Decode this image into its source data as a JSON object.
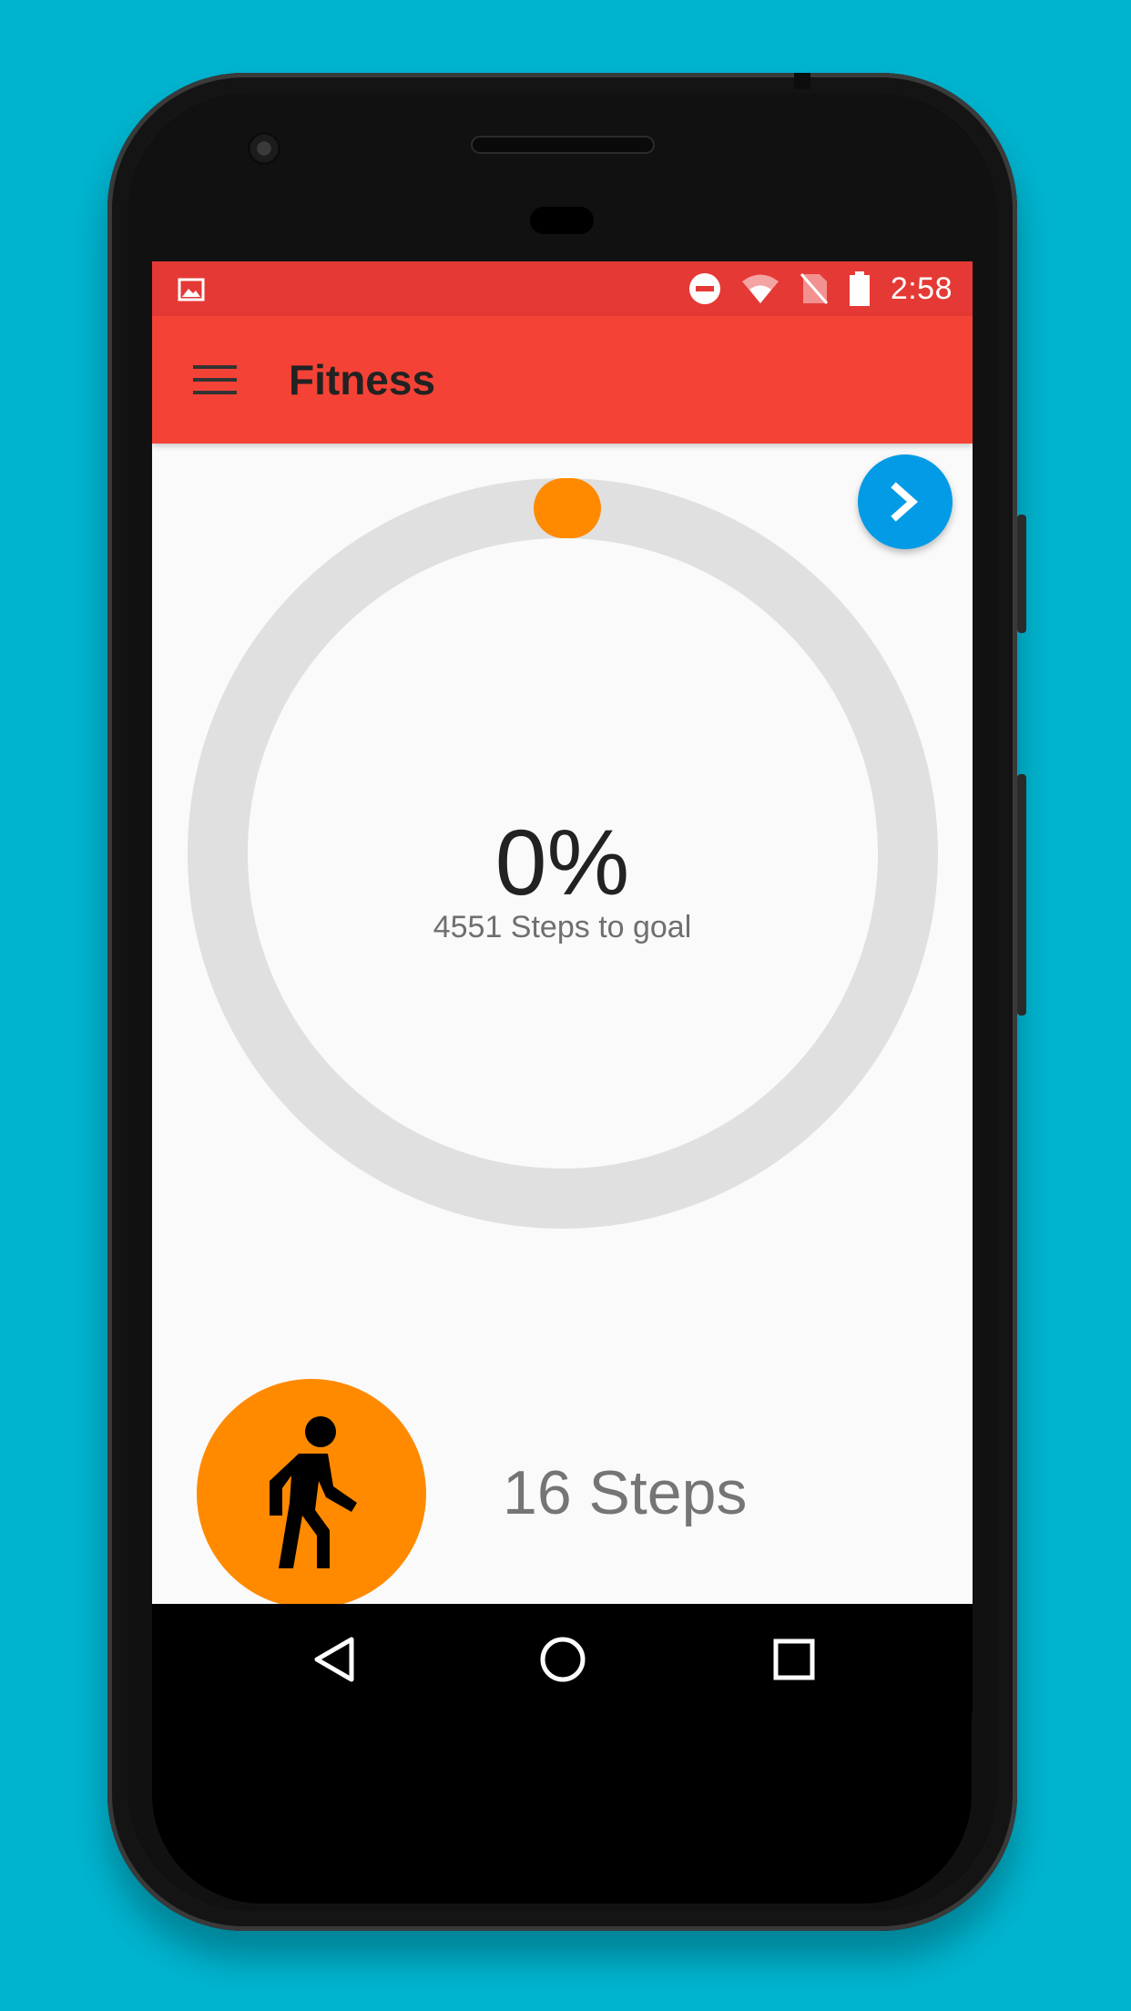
{
  "status_bar": {
    "time": "2:58",
    "icons": [
      "image-notification-icon",
      "do-not-disturb-icon",
      "wifi-icon",
      "no-sim-icon",
      "battery-icon"
    ]
  },
  "toolbar": {
    "title": "Fitness",
    "menu_icon": "hamburger-menu-icon"
  },
  "progress": {
    "percent_label": "0%",
    "percent_value": 0,
    "subtitle": "4551 Steps to goal"
  },
  "steps": {
    "label": "16 Steps"
  },
  "fab": {
    "icon": "chevron-right-icon"
  },
  "nav": {
    "back_icon": "back-icon",
    "home_icon": "home-icon",
    "recents_icon": "recents-icon"
  },
  "colors": {
    "background": "#00b4cf",
    "status_bar": "#e53935",
    "toolbar": "#f44336",
    "fab": "#039be5",
    "ring_track": "#e0e0e0",
    "ring_progress": "#ff8a00",
    "walker_circle": "#ff8a00"
  }
}
